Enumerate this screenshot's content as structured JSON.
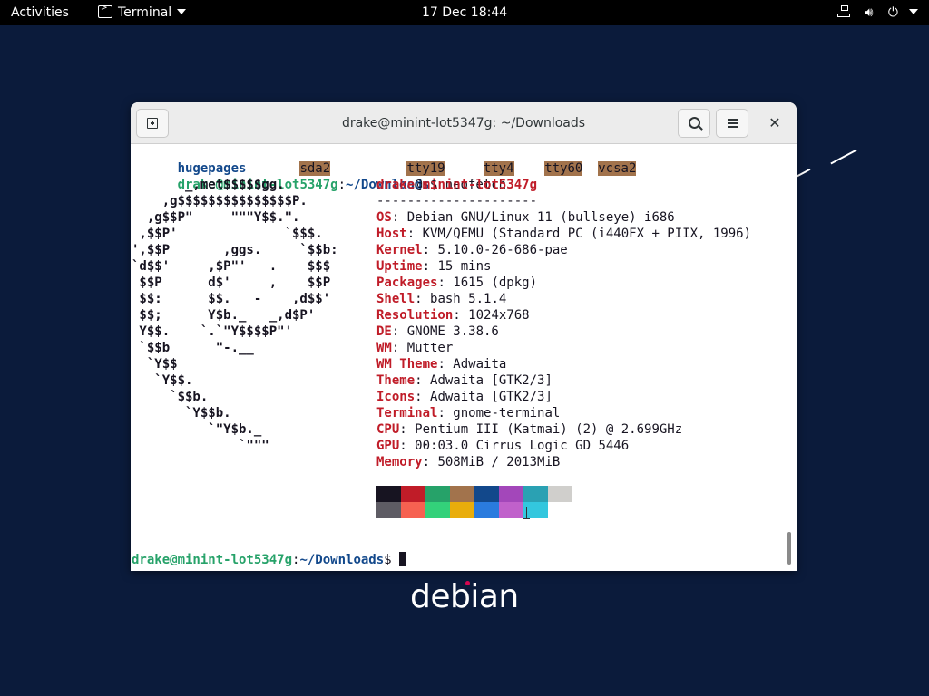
{
  "topbar": {
    "activities": "Activities",
    "app_name": "Terminal",
    "clock": "17 Dec  18:44"
  },
  "desktop": {
    "logo_text": "debian"
  },
  "window": {
    "title": "drake@minint-lot5347g: ~/Downloads"
  },
  "terminal": {
    "prev_line": {
      "items": [
        "hugepages",
        "sda2",
        "tty19",
        "tty4",
        "tty60",
        "vcsa2"
      ]
    },
    "prompt": {
      "user_host": "drake@minint-lot5347g",
      "sep": ":",
      "path": "~/Downloads",
      "symbol": "$",
      "command": " neofetch"
    },
    "ascii_art": [
      "       _,met$$$$$gg.",
      "    ,g$$$$$$$$$$$$$$$P.",
      "  ,g$$P\"     \"\"\"Y$$.\".",
      " ,$$P'              `$$$.",
      "',$$P       ,ggs.     `$$b:",
      "`d$$'     ,$P\"'   .    $$$",
      " $$P      d$'     ,    $$P",
      " $$:      $$.   -    ,d$$'",
      " $$;      Y$b._   _,d$P'",
      " Y$$.    `.`\"Y$$$$P\"'",
      " `$$b      \"-.__",
      "  `Y$$",
      "   `Y$$.",
      "     `$$b.",
      "       `Y$$b.",
      "          `\"Y$b._",
      "              `\"\"\""
    ],
    "info": {
      "user": "drake",
      "at": "@",
      "host": "minint-lot5347g",
      "separator": "---------------------",
      "rows": [
        {
          "key": "OS",
          "value": "Debian GNU/Linux 11 (bullseye) i686"
        },
        {
          "key": "Host",
          "value": "KVM/QEMU (Standard PC (i440FX + PIIX, 1996)"
        },
        {
          "key": "Kernel",
          "value": "5.10.0-26-686-pae"
        },
        {
          "key": "Uptime",
          "value": "15 mins"
        },
        {
          "key": "Packages",
          "value": "1615 (dpkg)"
        },
        {
          "key": "Shell",
          "value": "bash 5.1.4"
        },
        {
          "key": "Resolution",
          "value": "1024x768"
        },
        {
          "key": "DE",
          "value": "GNOME 3.38.6"
        },
        {
          "key": "WM",
          "value": "Mutter"
        },
        {
          "key": "WM Theme",
          "value": "Adwaita"
        },
        {
          "key": "Theme",
          "value": "Adwaita [GTK2/3]"
        },
        {
          "key": "Icons",
          "value": "Adwaita [GTK2/3]"
        },
        {
          "key": "Terminal",
          "value": "gnome-terminal"
        },
        {
          "key": "CPU",
          "value": "Pentium III (Katmai) (2) @ 2.699GHz"
        },
        {
          "key": "GPU",
          "value": "00:03.0 Cirrus Logic GD 5446"
        },
        {
          "key": "Memory",
          "value": "508MiB / 2013MiB"
        }
      ],
      "key_suffix": ": "
    },
    "palette": {
      "normal": [
        "#171421",
        "#c01c28",
        "#26a269",
        "#a2734c",
        "#12488b",
        "#a347ba",
        "#2aa1b3",
        "#d0cfcc"
      ],
      "bright": [
        "#5e5c64",
        "#f66151",
        "#33d17a",
        "#e9ad0c",
        "#2a7bde",
        "#c061cb",
        "#33c7de",
        "#ffffff"
      ]
    }
  }
}
